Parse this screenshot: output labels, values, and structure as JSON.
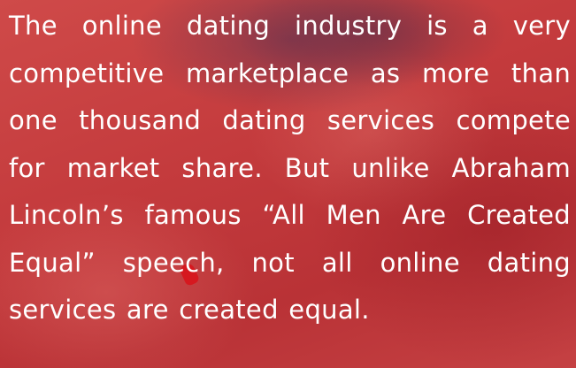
{
  "body_text": "The online dating industry is a very competitive marketplace as more than one thousand dating services compete for market share. But unlike Abraham Lincoln’s famous “All Men Are Created Equal” speech, not all online dating services are created equal.",
  "colors": {
    "overlay_red": "#c23a3c",
    "text": "#ffffff",
    "nail_red": "#d8141c"
  }
}
